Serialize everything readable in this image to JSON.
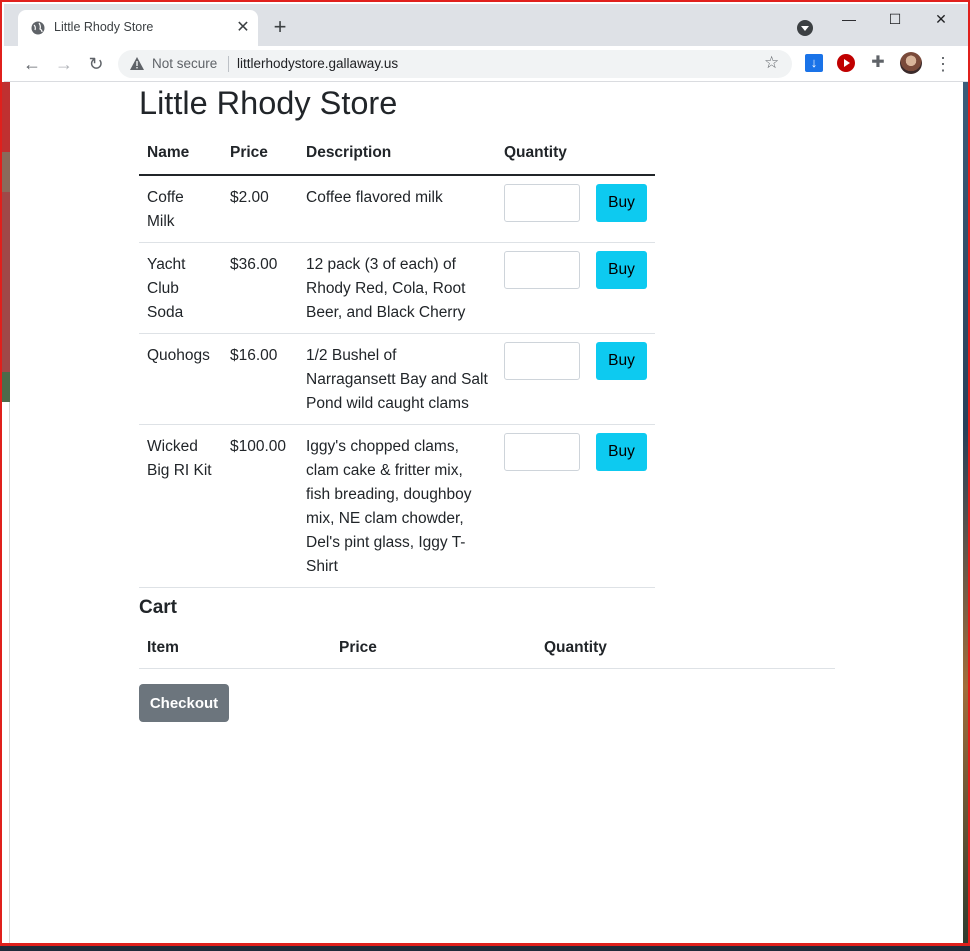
{
  "browser": {
    "tab_title": "Little Rhody Store",
    "tab_close": "✕",
    "new_tab": "+",
    "not_secure": "Not secure",
    "url": "littlerhodystore.gallaway.us",
    "window_controls": {
      "minimize": "—",
      "maximize": "☐",
      "close": "✕"
    },
    "icons": [
      "globe-icon",
      "back-icon",
      "forward-icon",
      "reload-icon",
      "warning-icon",
      "star-icon",
      "download-icon",
      "youtube-icon",
      "puzzle-icon",
      "profile-icon",
      "more-icon"
    ]
  },
  "page": {
    "title": "Little Rhody Store",
    "products_table": {
      "headers": [
        "Name",
        "Price",
        "Description",
        "Quantity"
      ],
      "buy_label": "Buy",
      "rows": [
        {
          "name": "Coffe Milk",
          "price": "$2.00",
          "description": "Coffee flavored milk"
        },
        {
          "name": "Yacht Club Soda",
          "price": "$36.00",
          "description": "12 pack (3 of each) of Rhody Red, Cola, Root Beer, and Black Cherry"
        },
        {
          "name": "Quohogs",
          "price": "$16.00",
          "description": "1/2 Bushel of Narragansett Bay and Salt Pond wild caught clams"
        },
        {
          "name": "Wicked Big RI Kit",
          "price": "$100.00",
          "description": "Iggy's chopped clams, clam cake & fritter mix, fish breading, doughboy mix, NE clam chowder, Del's pint glass, Iggy T-Shirt"
        }
      ]
    },
    "cart": {
      "title": "Cart",
      "headers": [
        "Item",
        "Price",
        "Quantity"
      ],
      "checkout_label": "Checkout"
    }
  },
  "colors": {
    "buy_button": "#0dcaf0",
    "checkout_button": "#6c757d",
    "window_border": "#e0201c"
  }
}
